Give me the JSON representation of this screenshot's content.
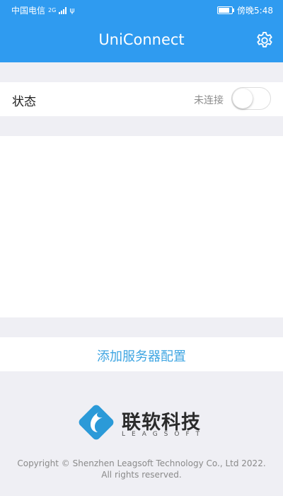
{
  "statusbar": {
    "carrier": "中国电信",
    "network": "2G",
    "time": "傍晚5:48",
    "battery_level": 0.85
  },
  "header": {
    "title": "UniConnect",
    "settings_icon": "gear-icon"
  },
  "status": {
    "label": "状态",
    "state": "未连接",
    "toggle_on": false
  },
  "actions": {
    "add_server": "添加服务器配置"
  },
  "footer": {
    "brand_cn": "联软科技",
    "brand_en": "LEAGSOFT",
    "copyright_line1": "Copyright © Shenzhen Leagsoft Technology Co., Ltd 2022.",
    "copyright_line2": "All rights reserved."
  },
  "colors": {
    "primary": "#2f9bf0",
    "link": "#3ea5e2",
    "background": "#efeff4"
  }
}
